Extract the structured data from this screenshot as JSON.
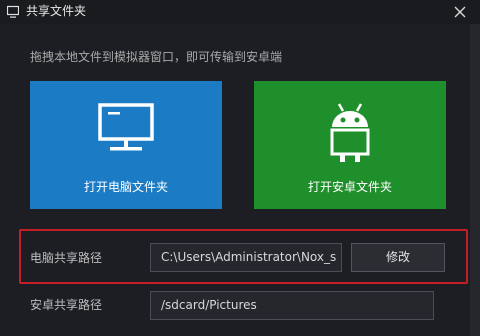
{
  "window": {
    "title": "共享文件夹",
    "window_icon": "monitor-icon",
    "close_icon": "close-icon"
  },
  "hint": "拖拽本地文件到模拟器窗口，即可传输到安卓端",
  "tiles": {
    "pc": {
      "label": "打开电脑文件夹",
      "icon": "monitor-icon",
      "color": "#1b7bc4"
    },
    "android": {
      "label": "打开安卓文件夹",
      "icon": "android-icon",
      "color": "#1f8f2b"
    }
  },
  "paths": {
    "pc": {
      "label": "电脑共享路径",
      "value": "C:\\Users\\Administrator\\Nox_s",
      "button_label": "修改"
    },
    "android": {
      "label": "安卓共享路径",
      "value": "/sdcard/Pictures"
    }
  },
  "colors": {
    "highlight_border": "#c41f24",
    "background": "#1d1e23"
  }
}
